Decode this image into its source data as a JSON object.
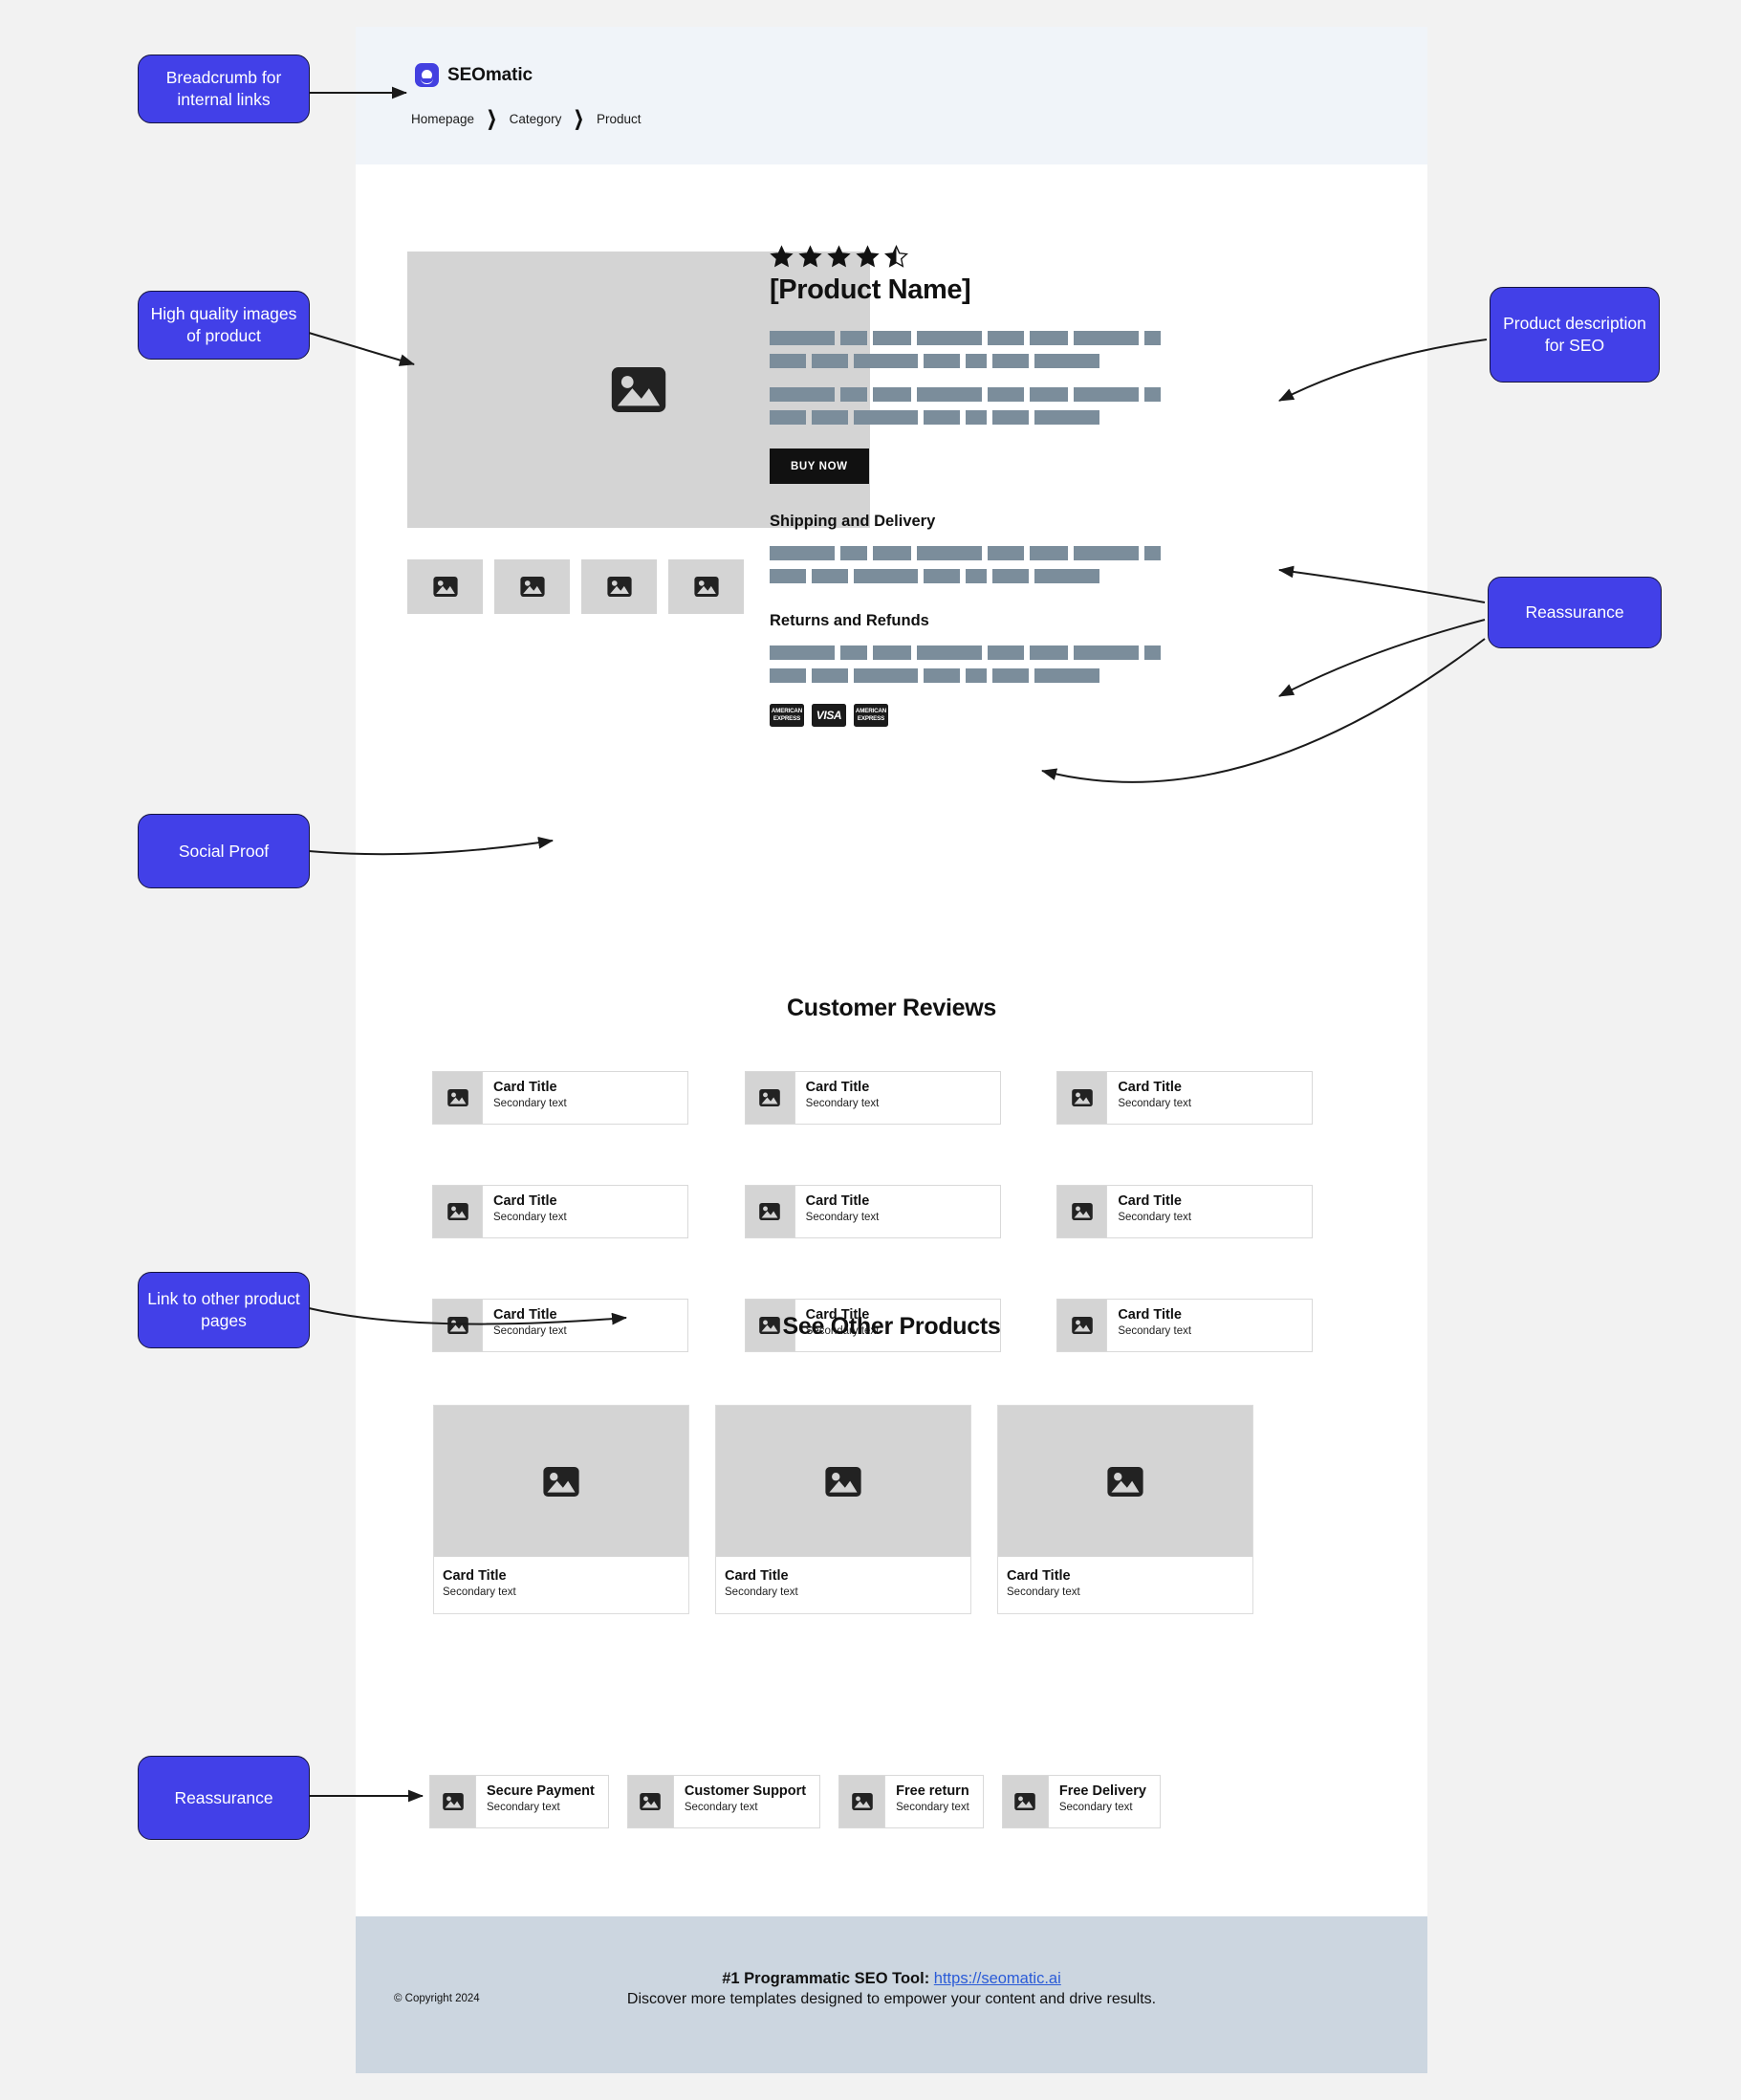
{
  "header": {
    "logo_text": "SEOmatic",
    "logo_icon": "seomatic-logo-icon",
    "breadcrumb": [
      "Homepage",
      "Category",
      "Product"
    ],
    "breadcrumb_separator": "❯"
  },
  "product": {
    "rating_stars": 4.5,
    "rating_star_count": 5,
    "title": "[Product Name]",
    "buy_button": "BUY NOW",
    "image_placeholder_icon": "image-icon",
    "thumbnail_count": 4,
    "description_paragraph_count": 2,
    "shipping_heading": "Shipping and Delivery",
    "returns_heading": "Returns and Refunds",
    "payment_badges": [
      "AMERICAN EXPRESS",
      "VISA",
      "AMERICAN EXPRESS"
    ]
  },
  "reviews": {
    "heading": "Customer Reviews",
    "cards": [
      {
        "title": "Card Title",
        "subtitle": "Secondary text"
      },
      {
        "title": "Card Title",
        "subtitle": "Secondary text"
      },
      {
        "title": "Card Title",
        "subtitle": "Secondary text"
      },
      {
        "title": "Card Title",
        "subtitle": "Secondary text"
      },
      {
        "title": "Card Title",
        "subtitle": "Secondary text"
      },
      {
        "title": "Card Title",
        "subtitle": "Secondary text"
      },
      {
        "title": "Card Title",
        "subtitle": "Secondary text"
      },
      {
        "title": "Card Title",
        "subtitle": "Secondary text"
      },
      {
        "title": "Card Title",
        "subtitle": "Secondary text"
      }
    ]
  },
  "other_products": {
    "heading": "See Other Products",
    "cards": [
      {
        "title": "Card Title",
        "subtitle": "Secondary text"
      },
      {
        "title": "Card Title",
        "subtitle": "Secondary text"
      },
      {
        "title": "Card Title",
        "subtitle": "Secondary text"
      }
    ]
  },
  "reassurance_strip": [
    {
      "title": "Secure Payment",
      "subtitle": "Secondary text"
    },
    {
      "title": "Customer Support",
      "subtitle": "Secondary text"
    },
    {
      "title": "Free return",
      "subtitle": "Secondary text"
    },
    {
      "title": "Free Delivery",
      "subtitle": "Secondary text"
    }
  ],
  "footer": {
    "copyright": "© Copyright 2024",
    "tagline_bold": "#1 Programmatic SEO Tool:",
    "link_text": "https://seomatic.ai",
    "subtext": "Discover more templates designed to empower your content and drive results."
  },
  "annotations": {
    "breadcrumb": "Breadcrumb for internal links",
    "images": "High quality images of product",
    "description": "Product description for SEO",
    "reassurance_right": "Reassurance",
    "social_proof": "Social Proof",
    "link_other": "Link to other product pages",
    "reassurance_bottom": "Reassurance"
  },
  "colors": {
    "accent": "#4240e8",
    "accent_border": "#15143f",
    "header_bg": "#f0f4f9",
    "footer_bg": "#ccd6e0",
    "placeholder_bg": "#d4d4d4",
    "text_bar": "#7b8d9b",
    "page_bg": "#f2f2f2",
    "buy_button_bg": "#111111",
    "link": "#2a5bd7"
  }
}
